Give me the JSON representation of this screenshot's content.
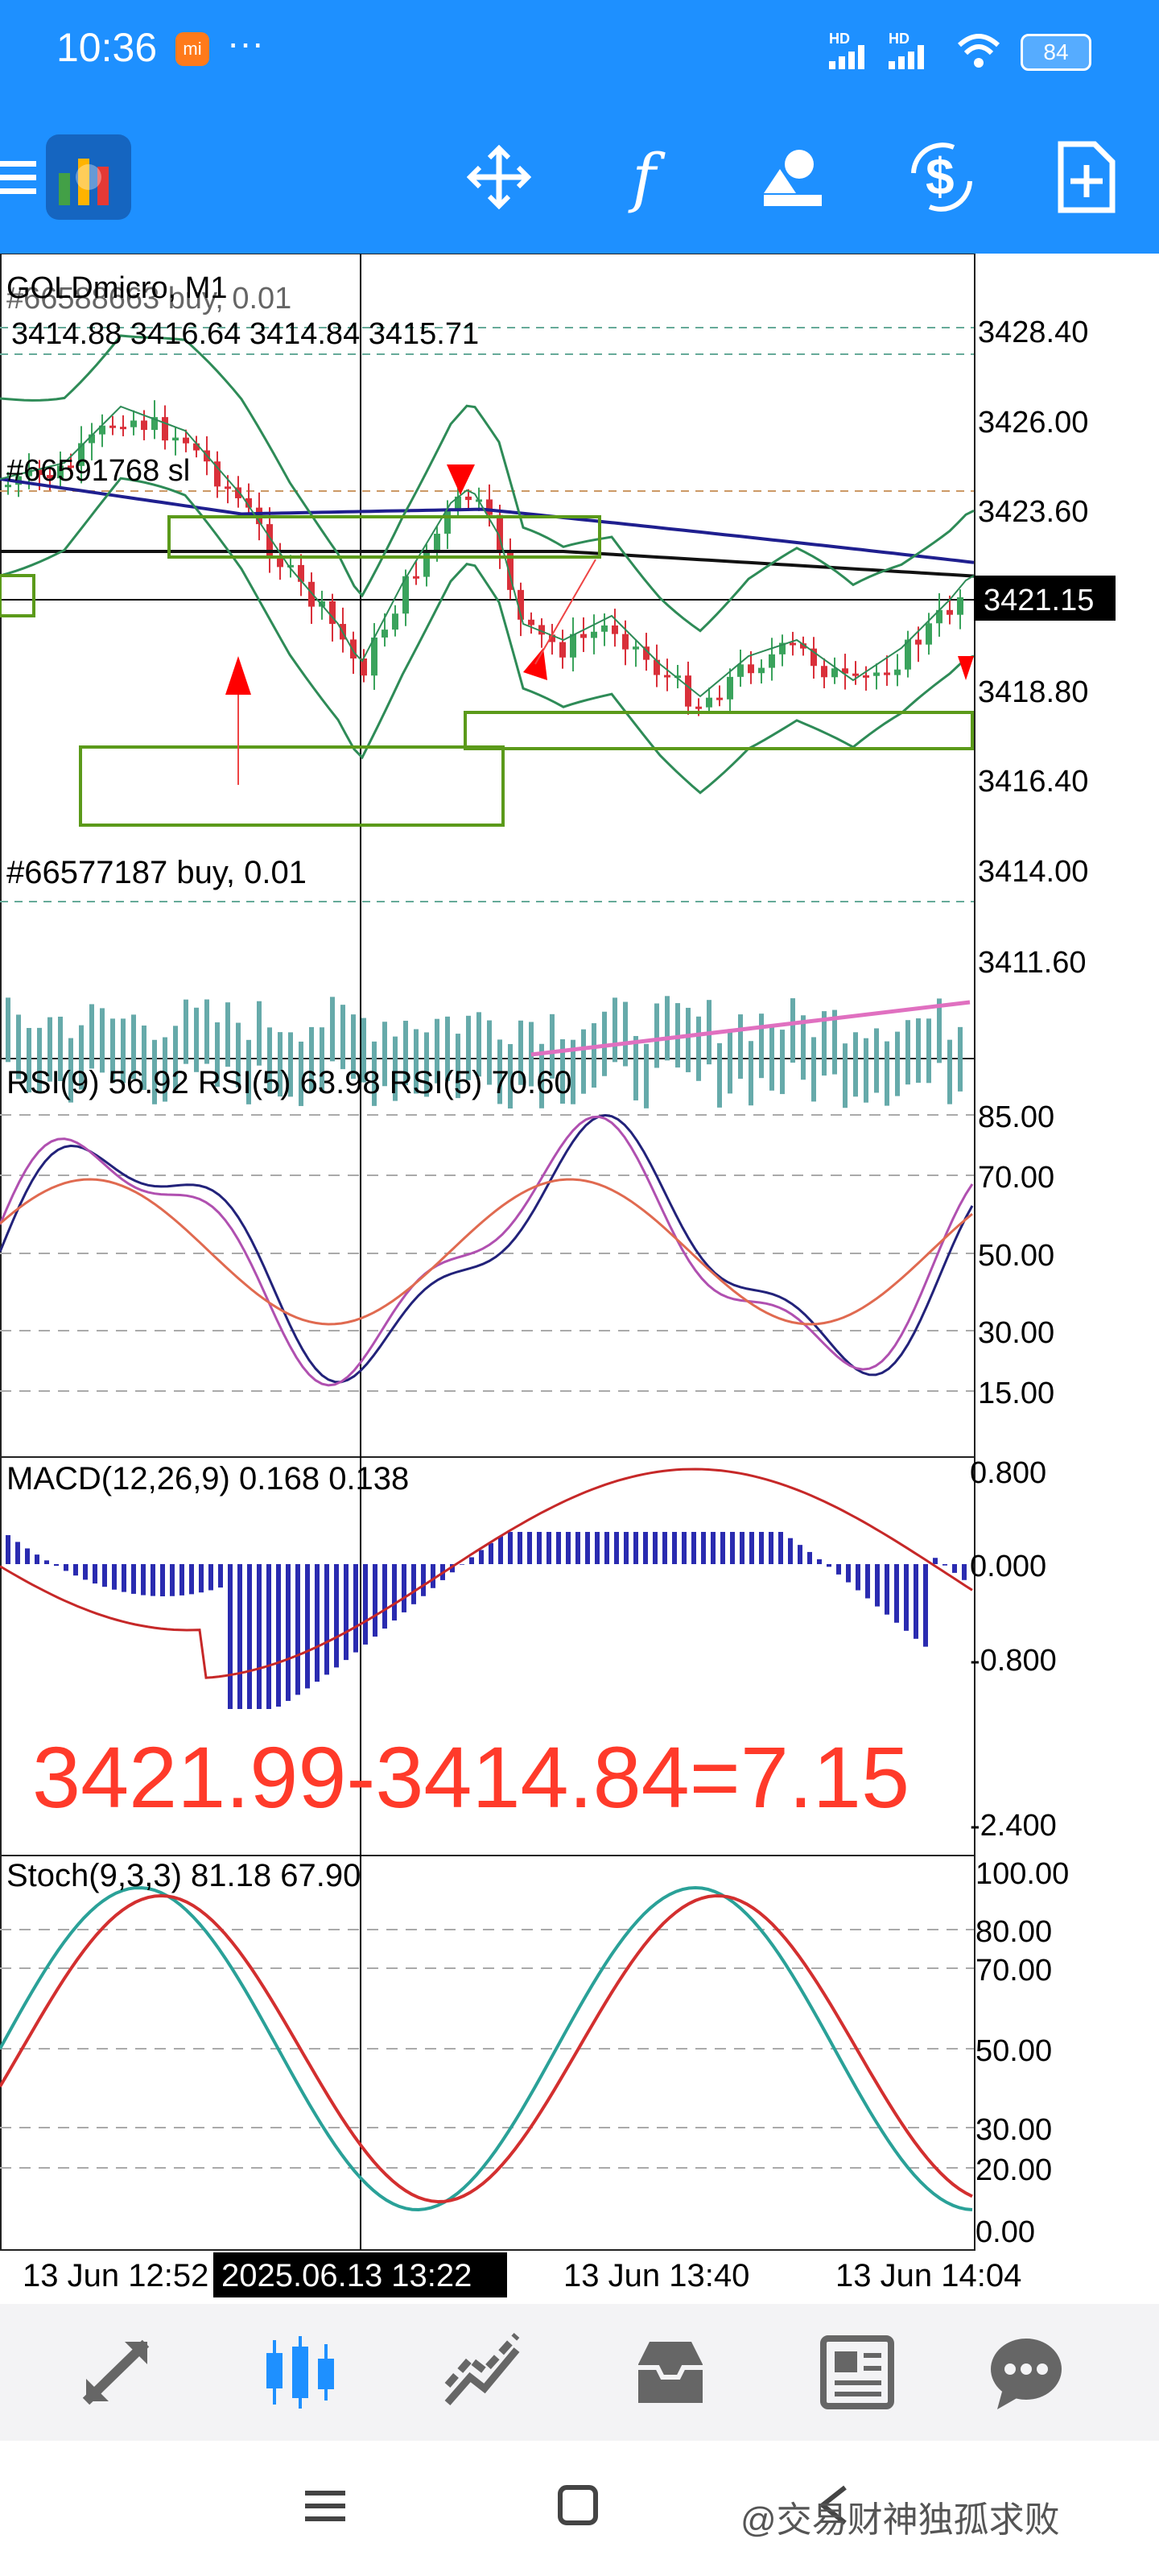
{
  "status_bar": {
    "time": "10:36",
    "mi_badge": "mi",
    "more": "···",
    "hd1": "HD",
    "hd2": "HD",
    "battery": "84"
  },
  "toolbar": {
    "icons": [
      "menu-icon",
      "metatrader-logo",
      "crosshair-icon",
      "function-icon",
      "objects-icon",
      "dollar-timeframe-icon",
      "new-order-icon"
    ]
  },
  "chart": {
    "header": {
      "symbol_line": "GOLDmicro, M1",
      "overlay_order_text": "#66588663 buy, 0.01",
      "ohlc": "3414.88 3416.64 3414.84 3415.71",
      "order_sl_label": "#66591768 sl",
      "order_buy_label": "#66577187 buy, 0.01"
    },
    "price_axis": [
      "3428.40",
      "3426.00",
      "3423.60",
      "3418.80",
      "3416.40",
      "3414.00",
      "3411.60"
    ],
    "current_price": "3421.15",
    "rsi": {
      "label": "RSI(9) 56.92 RSI(5) 63.98 RSI(5) 70.60",
      "levels": [
        "85.00",
        "70.00",
        "50.00",
        "30.00",
        "15.00"
      ]
    },
    "macd": {
      "label": "MACD(12,26,9) 0.168 0.138",
      "levels": [
        "0.800",
        "0.000",
        "-0.800",
        "-2.400"
      ]
    },
    "stoch": {
      "label": "Stoch(9,3,3) 81.18 67.90",
      "levels": [
        "100.00",
        "80.00",
        "70.00",
        "50.00",
        "30.00",
        "20.00",
        "0.00"
      ]
    },
    "annotation": "3421.99-3414.84=7.15",
    "time_axis": [
      "13 Jun 12:52",
      "2025.06.13 13:22",
      "13 Jun 13:40",
      "13 Jun 14:04"
    ],
    "colors": {
      "bull": "#3aa35c",
      "bear": "#d9303a",
      "macd_hist": "#2a2bb0",
      "ma_blue": "#1f1f8f",
      "band_green": "#2e8b57",
      "box_green": "#5b9a1a",
      "annotation_red": "#ff3a2a"
    }
  },
  "bottom_nav": {
    "items": [
      "trade-arrows-icon",
      "candles-icon",
      "chart-lines-icon",
      "inbox-icon",
      "news-icon",
      "chat-icon"
    ]
  },
  "system_nav": {
    "watermark": "@交易财神独孤求败"
  }
}
